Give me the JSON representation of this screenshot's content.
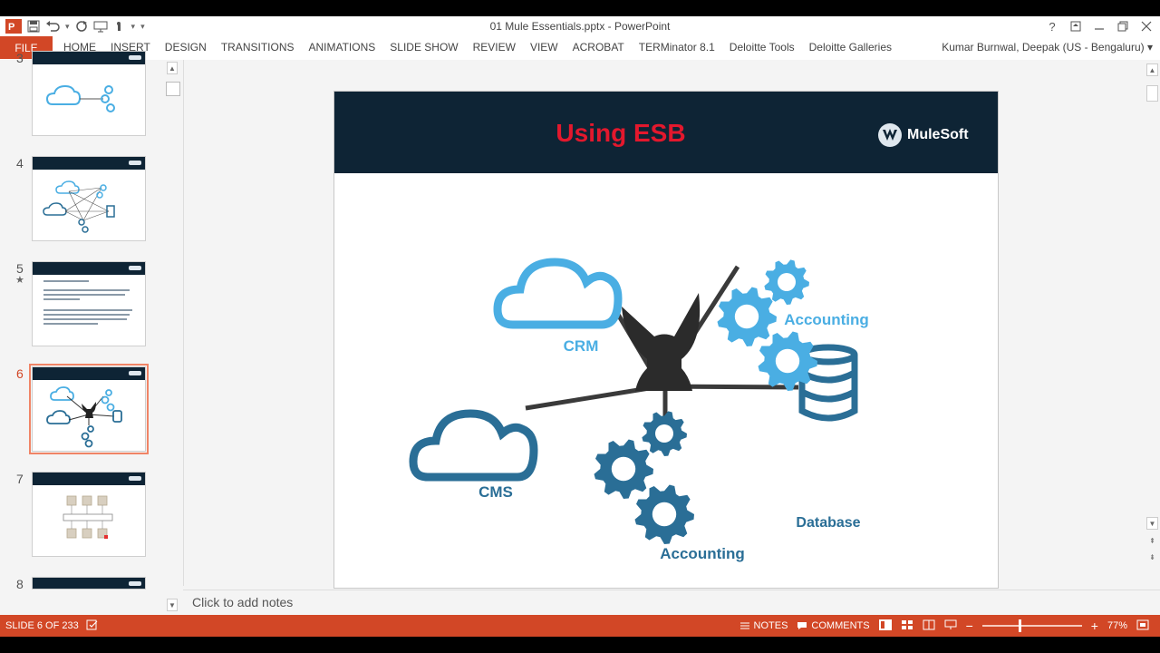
{
  "window": {
    "title": "01 Mule Essentials.pptx - PowerPoint",
    "user": "Kumar Burnwal, Deepak (US - Bengaluru)"
  },
  "ribbon": {
    "file_label": "FILE",
    "tabs": [
      "HOME",
      "INSERT",
      "DESIGN",
      "TRANSITIONS",
      "ANIMATIONS",
      "SLIDE SHOW",
      "REVIEW",
      "VIEW",
      "ACROBAT",
      "TERMinator 8.1",
      "Deloitte Tools",
      "Deloitte Galleries"
    ]
  },
  "thumbnails": [
    {
      "num": "3",
      "kind": "p2p-simple",
      "active": false,
      "star": false
    },
    {
      "num": "4",
      "kind": "p2p-mesh",
      "active": false,
      "star": false
    },
    {
      "num": "5",
      "kind": "text",
      "active": false,
      "star": true
    },
    {
      "num": "6",
      "kind": "esb",
      "active": true,
      "star": false
    },
    {
      "num": "7",
      "kind": "esb-servers",
      "active": false,
      "star": false
    },
    {
      "num": "8",
      "kind": "partial",
      "active": false,
      "star": false
    }
  ],
  "slide": {
    "title": "Using ESB",
    "logo_text": "MuleSoft",
    "labels": {
      "crm": "CRM",
      "cms": "CMS",
      "accounting_top": "Accounting",
      "accounting_bottom": "Accounting",
      "database": "Database"
    },
    "colors": {
      "header": "#0e2435",
      "title": "#e3182d",
      "light_blue": "#4aaee3",
      "dark_blue": "#2a6e96",
      "hub": "#2b2b2b"
    }
  },
  "notes": {
    "placeholder": "Click to add notes"
  },
  "statusbar": {
    "slide_info": "SLIDE 6 OF 233",
    "notes_label": "NOTES",
    "comments_label": "COMMENTS",
    "zoom": "77%",
    "zoom_value": 77,
    "accent": "#d24726"
  }
}
